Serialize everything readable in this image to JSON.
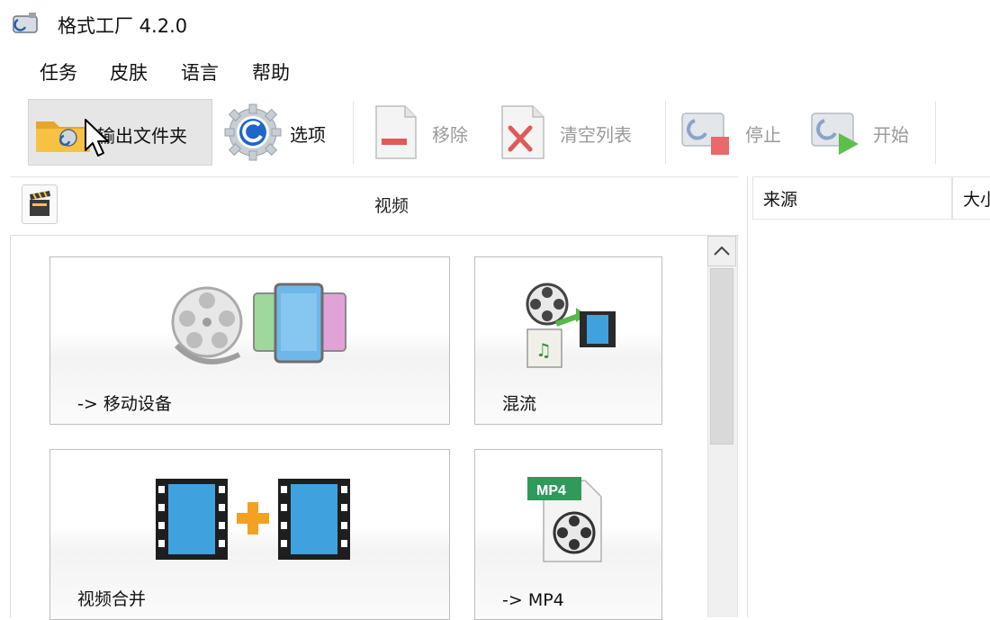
{
  "window": {
    "title": "格式工厂 4.2.0"
  },
  "menu": {
    "items": [
      {
        "label": "任务"
      },
      {
        "label": "皮肤"
      },
      {
        "label": "语言"
      },
      {
        "label": "帮助"
      }
    ]
  },
  "toolbar": {
    "output_folder": "输出文件夹",
    "options": "选项",
    "remove": "移除",
    "clear_list": "清空列表",
    "stop": "停止",
    "start": "开始"
  },
  "category": {
    "title": "视频"
  },
  "tiles": [
    {
      "label": "-> 移动设备"
    },
    {
      "label": "混流"
    },
    {
      "label": "视频合并"
    },
    {
      "label": "-> MP4"
    }
  ],
  "file_list": {
    "columns": [
      {
        "label": "来源"
      },
      {
        "label": "大小"
      }
    ]
  },
  "colors": {
    "disabled_text": "#9a9a9a",
    "selected_button": "#e6e6e6",
    "accent_orange": "#f5a020",
    "accent_blue": "#2a9fd8"
  },
  "icons": [
    "app-icon",
    "folder-icon",
    "gear-icon",
    "remove-page-icon",
    "clear-list-icon",
    "stop-icon",
    "start-icon",
    "clapperboard-icon",
    "film-reel-icon",
    "mp4-file-icon",
    "cursor-icon"
  ]
}
